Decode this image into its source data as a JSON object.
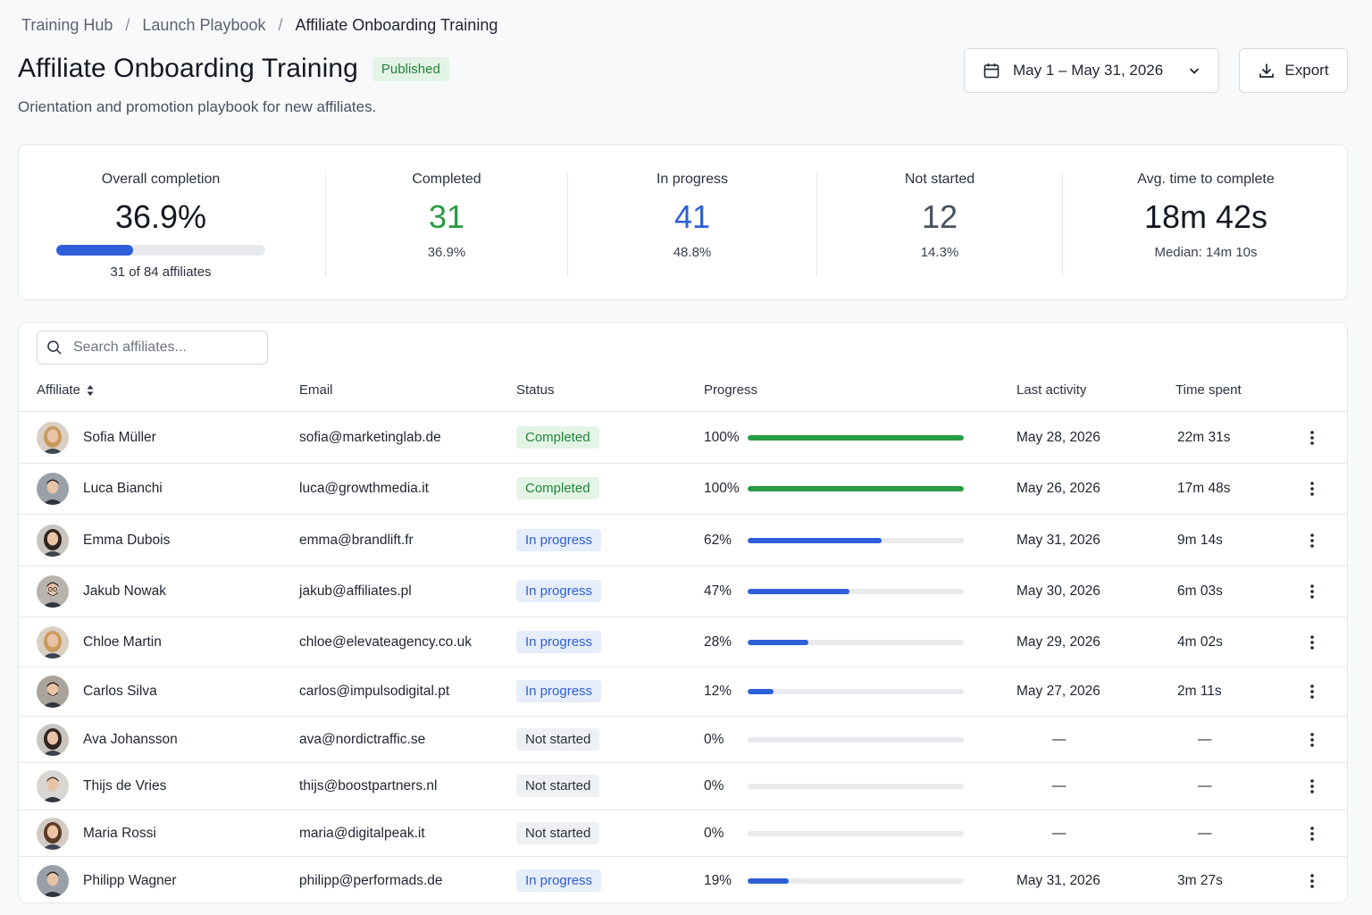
{
  "breadcrumb": [
    "Training Hub",
    "Launch Playbook",
    "Affiliate Onboarding Training"
  ],
  "header": {
    "title": "Affiliate Onboarding Training",
    "badge": "Published",
    "subtitle": "Orientation and promotion playbook for new affiliates.",
    "date_range": "May 1 – May 31, 2026",
    "export_label": "Export"
  },
  "stats": {
    "overall": {
      "label": "Overall completion",
      "value": "36.9%",
      "fraction": 0.369,
      "sub": "31 of 84 affiliates"
    },
    "completed": {
      "label": "Completed",
      "value": "31",
      "sub": "36.9%"
    },
    "in_progress": {
      "label": "In progress",
      "value": "41",
      "sub": "48.8%"
    },
    "not_started": {
      "label": "Not started",
      "value": "12",
      "sub": "14.3%"
    },
    "avg_time": {
      "label": "Avg. time to complete",
      "value": "18m 42s",
      "sub": "Median: 14m 10s"
    }
  },
  "colors": {
    "completed": "#2a9a45",
    "in_progress": "#2e5fd9",
    "not_started": "#4a5160"
  },
  "search": {
    "placeholder": "Search affiliates..."
  },
  "columns": {
    "affiliate": "Affiliate",
    "email": "Email",
    "status": "Status",
    "progress": "Progress",
    "last_activity": "Last activity",
    "time_spent": "Time spent"
  },
  "rows": [
    {
      "name": "Sofia Müller",
      "email": "sofia@marketinglab.de",
      "status": "Completed",
      "status_key": "completed",
      "progress": 100,
      "progress_label": "100%",
      "last_activity": "May 28, 2026",
      "time_spent": "22m 31s",
      "avatar": "female-blonde"
    },
    {
      "name": "Luca Bianchi",
      "email": "luca@growthmedia.it",
      "status": "Completed",
      "status_key": "completed",
      "progress": 100,
      "progress_label": "100%",
      "last_activity": "May 26, 2026",
      "time_spent": "17m 48s",
      "avatar": "male-dark"
    },
    {
      "name": "Emma Dubois",
      "email": "emma@brandlift.fr",
      "status": "In progress",
      "status_key": "inprogress",
      "progress": 62,
      "progress_label": "62%",
      "last_activity": "May 31, 2026",
      "time_spent": "9m 14s",
      "avatar": "female-dark"
    },
    {
      "name": "Jakub Nowak",
      "email": "jakub@affiliates.pl",
      "status": "In progress",
      "status_key": "inprogress",
      "progress": 47,
      "progress_label": "47%",
      "last_activity": "May 30, 2026",
      "time_spent": "6m 03s",
      "avatar": "male-glasses"
    },
    {
      "name": "Chloe Martin",
      "email": "chloe@elevateagency.co.uk",
      "status": "In progress",
      "status_key": "inprogress",
      "progress": 28,
      "progress_label": "28%",
      "last_activity": "May 29, 2026",
      "time_spent": "4m 02s",
      "avatar": "female-blonde"
    },
    {
      "name": "Carlos Silva",
      "email": "carlos@impulsodigital.pt",
      "status": "In progress",
      "status_key": "inprogress",
      "progress": 12,
      "progress_label": "12%",
      "last_activity": "May 27, 2026",
      "time_spent": "2m 11s",
      "avatar": "male-beard"
    },
    {
      "name": "Ava Johansson",
      "email": "ava@nordictraffic.se",
      "status": "Not started",
      "status_key": "notstarted",
      "progress": 0,
      "progress_label": "0%",
      "last_activity": "—",
      "time_spent": "—",
      "avatar": "female-dark"
    },
    {
      "name": "Thijs de Vries",
      "email": "thijs@boostpartners.nl",
      "status": "Not started",
      "status_key": "notstarted",
      "progress": 0,
      "progress_label": "0%",
      "last_activity": "—",
      "time_spent": "—",
      "avatar": "male-light"
    },
    {
      "name": "Maria Rossi",
      "email": "maria@digitalpeak.it",
      "status": "Not started",
      "status_key": "notstarted",
      "progress": 0,
      "progress_label": "0%",
      "last_activity": "—",
      "time_spent": "—",
      "avatar": "female-brown"
    },
    {
      "name": "Philipp Wagner",
      "email": "philipp@performads.de",
      "status": "In progress",
      "status_key": "inprogress",
      "progress": 19,
      "progress_label": "19%",
      "last_activity": "May 31, 2026",
      "time_spent": "3m 27s",
      "avatar": "male-dark"
    }
  ]
}
